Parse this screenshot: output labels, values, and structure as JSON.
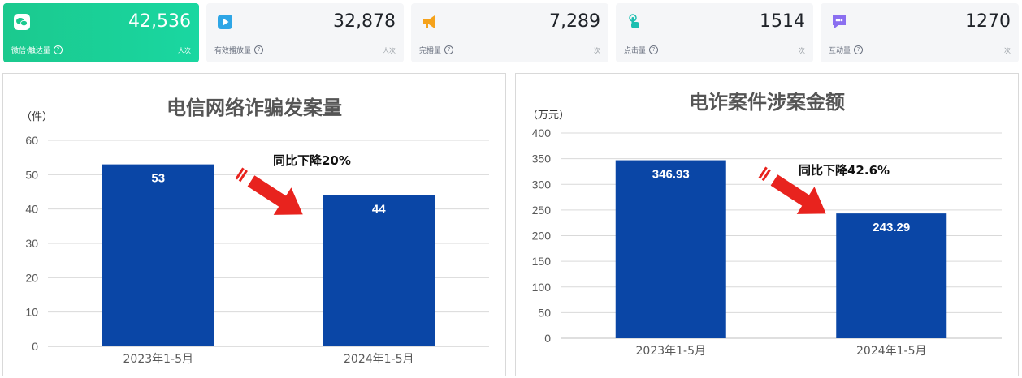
{
  "stats": [
    {
      "value": "42,536",
      "label": "微信·触达量",
      "unit": "人次",
      "icon": "wechat-icon",
      "color": "#ffffff"
    },
    {
      "value": "32,878",
      "label": "有效播放量",
      "unit": "人次",
      "icon": "play-icon",
      "color": "#2ea6e6"
    },
    {
      "value": "7,289",
      "label": "完播量",
      "unit": "次",
      "icon": "megaphone-icon",
      "color": "#f5a21b"
    },
    {
      "value": "1514",
      "label": "点击量",
      "unit": "次",
      "icon": "tap-icon",
      "color": "#1bbfb0"
    },
    {
      "value": "1270",
      "label": "互动量",
      "unit": "次",
      "icon": "chat-icon",
      "color": "#8b6ff0"
    }
  ],
  "chart_data": [
    {
      "type": "bar",
      "title": "电信网络诈骗发案量",
      "ylabel": "（件）",
      "categories": [
        "2023年1-5月",
        "2024年1-5月"
      ],
      "values": [
        53,
        44
      ],
      "value_labels": [
        "53",
        "44"
      ],
      "ylim": [
        0,
        60
      ],
      "yticks": [
        "0",
        "10",
        "20",
        "30",
        "40",
        "50",
        "60"
      ],
      "annotation": "同比下降20%",
      "bar_color": "#0a46a6",
      "arrow_color": "#e8231e",
      "grid": true
    },
    {
      "type": "bar",
      "title": "电诈案件涉案金额",
      "ylabel": "（万元）",
      "categories": [
        "2023年1-5月",
        "2024年1-5月"
      ],
      "values": [
        346.93,
        243.29
      ],
      "value_labels": [
        "346.93",
        "243.29"
      ],
      "ylim": [
        0,
        400
      ],
      "yticks": [
        "0",
        "50",
        "100",
        "150",
        "200",
        "250",
        "300",
        "350",
        "400"
      ],
      "annotation": "同比下降42.6%",
      "bar_color": "#0a46a6",
      "arrow_color": "#e8231e",
      "grid": true
    }
  ]
}
